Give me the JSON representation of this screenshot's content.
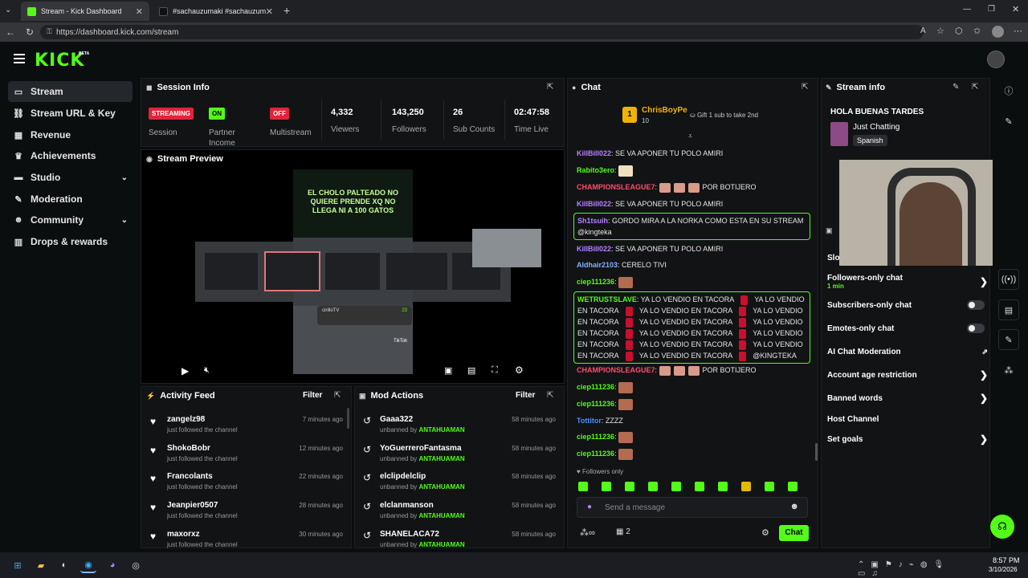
{
  "browser": {
    "tabs": [
      {
        "title": "Stream - Kick Dashboard"
      },
      {
        "title": "#sachauzumaki #sachauzumakiclip"
      }
    ],
    "url": "https://dashboard.kick.com/stream"
  },
  "app": {
    "logo": "KICK",
    "logo_badge": "BETA"
  },
  "sidebar": {
    "items": [
      {
        "label": "Stream",
        "icon": "stream-icon"
      },
      {
        "label": "Stream URL & Key",
        "icon": "link-icon"
      },
      {
        "label": "Revenue",
        "icon": "revenue-icon"
      },
      {
        "label": "Achievements",
        "icon": "trophy-icon"
      },
      {
        "label": "Studio",
        "icon": "studio-icon"
      },
      {
        "label": "Moderation",
        "icon": "wrench-icon"
      },
      {
        "label": "Community",
        "icon": "community-icon"
      },
      {
        "label": "Drops & rewards",
        "icon": "gift-icon"
      }
    ]
  },
  "session": {
    "title": "Session Info",
    "streaming_badge": "STREAMING",
    "session_label": "Session",
    "on_badge": "ON",
    "partner_label": "Partner Income",
    "off_badge": "OFF",
    "multistream_label": "Multistream",
    "viewers": "4,332",
    "viewers_label": "Viewers",
    "followers": "143,250",
    "followers_label": "Followers",
    "subs": "26",
    "subs_label": "Sub Counts",
    "time_live": "02:47:58",
    "time_live_label": "Time Live"
  },
  "preview": {
    "title": "Stream Preview",
    "overlay_text": "EL CHOLO PALTEADO NO QUIERE PRENDE XQ NO LLEGA NI A 100 GATOS",
    "inner_user": "cirilloTV",
    "inner_count": "23",
    "inner_brand": "TikTok"
  },
  "activity": {
    "title": "Activity Feed",
    "filter": "Filter",
    "rows": [
      {
        "name": "zangelz98",
        "sub": "just followed the channel",
        "time": "7 minutes ago"
      },
      {
        "name": "ShokoBobr",
        "sub": "just followed the channel",
        "time": "12 minutes ago"
      },
      {
        "name": "Francolants",
        "sub": "just followed the channel",
        "time": "22 minutes ago"
      },
      {
        "name": "Jeanpier0507",
        "sub": "just followed the channel",
        "time": "28 minutes ago"
      },
      {
        "name": "maxorxz",
        "sub": "just followed the channel",
        "time": "30 minutes ago"
      }
    ]
  },
  "mod": {
    "title": "Mod Actions",
    "filter": "Filter",
    "unbanned_by": "unbanned by",
    "rows": [
      {
        "name": "Gaaa322",
        "by": "ANTAHUAMAN",
        "time": "58 minutes ago"
      },
      {
        "name": "YoGuerreroFantasma",
        "by": "ANTAHUAMAN",
        "time": "58 minutes ago"
      },
      {
        "name": "elclipdelclip",
        "by": "ANTAHUAMAN",
        "time": "58 minutes ago"
      },
      {
        "name": "elclanmanson",
        "by": "ANTAHUAMAN",
        "time": "58 minutes ago"
      },
      {
        "name": "SHANELACA72",
        "by": "ANTAHUAMAN",
        "time": "58 minutes ago"
      }
    ]
  },
  "chat": {
    "title": "Chat",
    "pinned_user": "ChrisBoyPe",
    "pinned_rank": "1",
    "pinned_count": "10",
    "gift_text": "Gift 1 sub to take 2nd",
    "messages": [
      {
        "user": "KillBill022",
        "color": "#b780ff",
        "text": "SE VA APONER TU POLO AMIRI"
      },
      {
        "user": "Rabito3ero",
        "color": "#53fc18",
        "text": ""
      },
      {
        "user": "CHAMPIONSLEAGUE7",
        "color": "#ff4d6d",
        "text": "POR BOTIJERO"
      },
      {
        "user": "KillBill022",
        "color": "#b780ff",
        "text": "SE VA APONER TU POLO AMIRI"
      },
      {
        "user": "Sh1tsuih",
        "color": "#b780ff",
        "text": "GORDO MIRA A LA NORKA COMO ESTA EN SU STREAM @kingteka"
      },
      {
        "user": "KillBill022",
        "color": "#b780ff",
        "text": "SE VA APONER TU POLO AMIRI"
      },
      {
        "user": "Aldhair2103",
        "color": "#7fb2ff",
        "text": "CERELO TIVI"
      },
      {
        "user": "ciep111236",
        "color": "#53fc18",
        "text": ""
      },
      {
        "user": "WETRUSTSLAVE",
        "color": "#53fc18",
        "text": "YA LO VENDIO EN TACORA"
      },
      {
        "user": "CHAMPIONSLEAGUE7",
        "color": "#ff4d6d",
        "text": "POR BOTIJERO"
      },
      {
        "user": "ciep111236",
        "color": "#53fc18",
        "text": ""
      },
      {
        "user": "ciep111236",
        "color": "#53fc18",
        "text": ""
      },
      {
        "user": "Tottitor",
        "color": "#4d8bff",
        "text": "ZZZZ"
      },
      {
        "user": "ciep111236",
        "color": "#53fc18",
        "text": ""
      },
      {
        "user": "ciep111236",
        "color": "#53fc18",
        "text": ""
      }
    ],
    "wetrust_end": "@KINGTEKA",
    "followers_only": "Followers only",
    "placeholder": "Send a message",
    "viewer_count": "2",
    "send_label": "Chat"
  },
  "stream_info": {
    "title": "Stream info",
    "stream_title": "HOLA BUENAS TARDES",
    "category": "Just Chatting",
    "language": "Spanish",
    "slow_mode_label": "Slo",
    "settings": [
      {
        "label": "Followers-only chat",
        "sub": "1 min",
        "control": "arrow"
      },
      {
        "label": "Subscribers-only chat",
        "control": "toggle"
      },
      {
        "label": "Emotes-only chat",
        "control": "toggle"
      },
      {
        "label": "AI Chat Moderation",
        "control": "external"
      },
      {
        "label": "Account age restriction",
        "control": "arrow"
      },
      {
        "label": "Banned words",
        "control": "arrow"
      },
      {
        "label": "Host Channel",
        "control": "none"
      },
      {
        "label": "Set goals",
        "control": "arrow"
      }
    ]
  },
  "taskbar": {
    "time": "8:57 PM",
    "date": "3/10/2026"
  },
  "colors": {
    "accent": "#53fc18",
    "danger": "#e0243b",
    "panel": "#111315"
  }
}
